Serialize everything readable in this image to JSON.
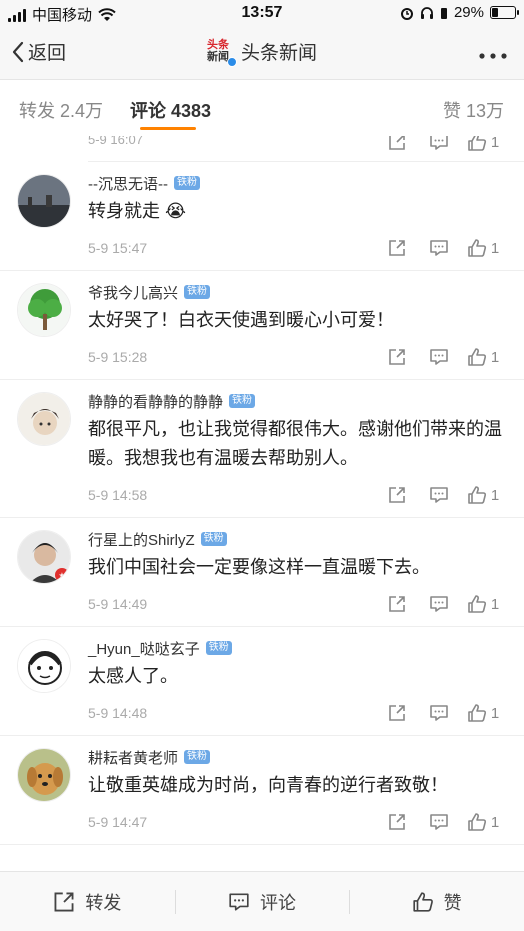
{
  "status": {
    "carrier": "中国移动",
    "time": "13:57",
    "battery_percent": "29%",
    "battery_level": 0.29
  },
  "nav": {
    "back_label": "返回",
    "title": "头条新闻",
    "logo_line1": "头条",
    "logo_line2": "新闻"
  },
  "tabs": {
    "repost": "转发 2.4万",
    "comment": "评论 4383",
    "like": "赞 13万"
  },
  "partial_comment": {
    "time": "5-9 16:07",
    "likes": "1"
  },
  "comments": [
    {
      "name": "--沉思无语--",
      "badge": "铁粉",
      "text": "转身就走 😭",
      "time": "5-9 15:47",
      "likes": "1",
      "avatar": "landscape"
    },
    {
      "name": "爷我今儿高兴",
      "badge": "铁粉",
      "text": "太好哭了！白衣天使遇到暖心小可爱！",
      "time": "5-9 15:28",
      "likes": "1",
      "avatar": "tree"
    },
    {
      "name": "静静的看静静的静静",
      "badge": "铁粉",
      "text": "都很平凡，也让我觉得都很伟大。感谢他们带来的温暖。我想我也有温暖去帮助别人。",
      "time": "5-9 14:58",
      "likes": "1",
      "avatar": "sketch"
    },
    {
      "name": "行星上的ShirlyZ",
      "badge": "铁粉",
      "text": "我们中国社会一定要像这样一直温暖下去。",
      "time": "5-9 14:49",
      "likes": "1",
      "avatar": "portrait"
    },
    {
      "name": "_Hyun_哒哒玄子",
      "badge": "铁粉",
      "text": "太感人了。",
      "time": "5-9 14:48",
      "likes": "1",
      "avatar": "cartoon"
    },
    {
      "name": "耕耘者黄老师",
      "badge": "铁粉",
      "text": "让敬重英雄成为时尚，向青春的逆行者致敬！",
      "time": "5-9 14:47",
      "likes": "1",
      "avatar": "dog"
    }
  ],
  "bottom_bar": {
    "repost": "转发",
    "comment": "评论",
    "like": "赞"
  },
  "colors": {
    "accent": "#ff8200",
    "badge": "#6ca8e6",
    "vip": "#2b8ce8"
  },
  "icons": [
    "back-chevron-icon",
    "more-icon",
    "share-icon",
    "comment-icon",
    "like-icon"
  ]
}
